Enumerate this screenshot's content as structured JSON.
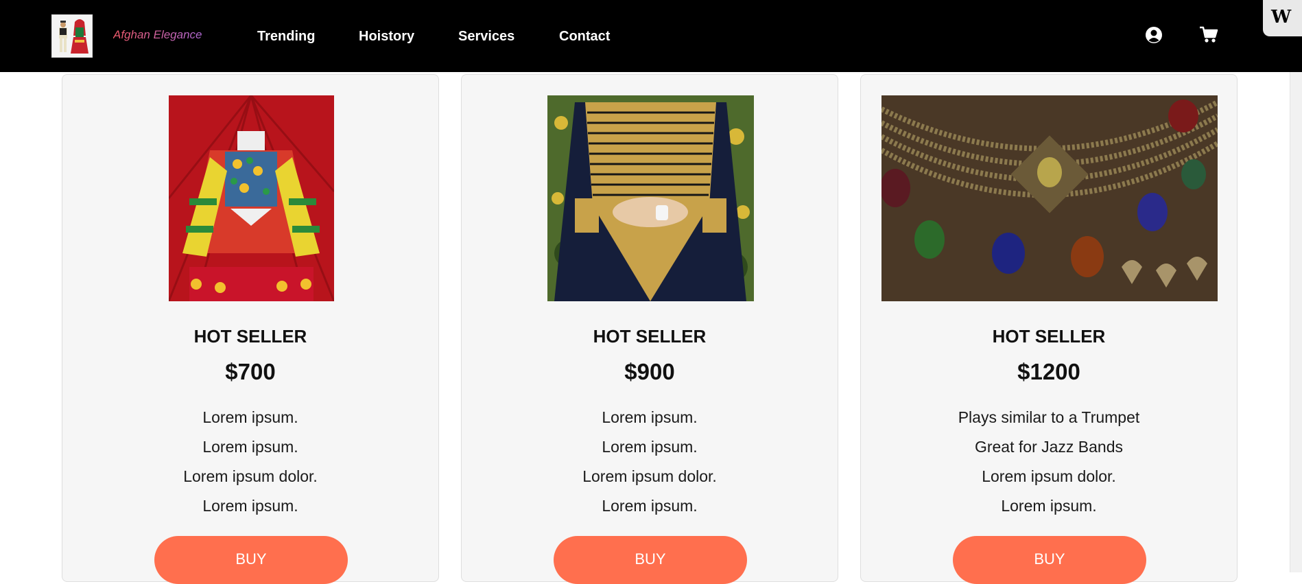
{
  "header": {
    "brand": "Afghan Elegance",
    "nav": [
      {
        "label": "Trending"
      },
      {
        "label": "Hoistory"
      },
      {
        "label": "Services"
      },
      {
        "label": "Contact"
      }
    ]
  },
  "icons": {
    "account": "user-circle-icon",
    "cart": "shopping-cart-icon",
    "badge": "wix-logo-icon"
  },
  "colors": {
    "navbar": "#000000",
    "button": "#ff6f4e",
    "card": "#f6f6f6"
  },
  "products": [
    {
      "badge": "HOT SELLER",
      "price": "$700",
      "features": [
        "Lorem ipsum.",
        "Lorem ipsum.",
        "Lorem ipsum dolor.",
        "Lorem ipsum."
      ],
      "buy": "BUY"
    },
    {
      "badge": "HOT SELLER",
      "price": "$900",
      "features": [
        "Lorem ipsum.",
        "Lorem ipsum.",
        "Lorem ipsum dolor.",
        "Lorem ipsum."
      ],
      "buy": "BUY"
    },
    {
      "badge": "HOT SELLER",
      "price": "$1200",
      "features": [
        "Plays similar to a Trumpet",
        "Great for Jazz Bands",
        "Lorem ipsum dolor.",
        "Lorem ipsum."
      ],
      "buy": "BUY"
    }
  ]
}
